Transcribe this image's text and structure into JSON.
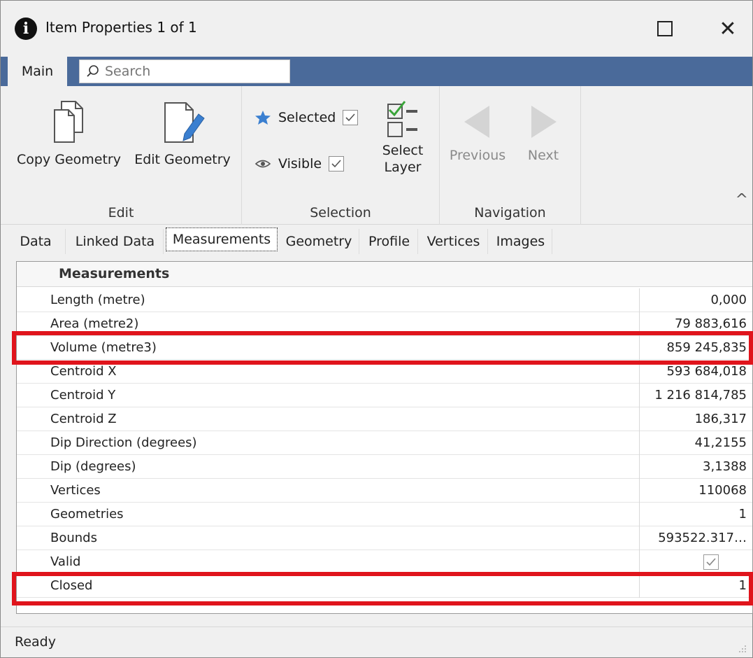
{
  "window": {
    "title": "Item Properties 1 of 1"
  },
  "ribbon": {
    "tab_main": "Main",
    "search_placeholder": "Search",
    "groups": {
      "edit": {
        "label": "Edit",
        "copy_geometry": "Copy Geometry",
        "edit_geometry": "Edit Geometry"
      },
      "selection": {
        "label": "Selection",
        "selected": "Selected",
        "selected_checked": true,
        "visible": "Visible",
        "visible_checked": true,
        "select_layer_line1": "Select",
        "select_layer_line2": "Layer"
      },
      "navigation": {
        "label": "Navigation",
        "previous": "Previous",
        "next": "Next"
      }
    }
  },
  "page_tabs": [
    "Data",
    "Linked Data",
    "Measurements",
    "Geometry",
    "Profile",
    "Vertices",
    "Images"
  ],
  "active_tab": "Measurements",
  "grid": {
    "header": "Measurements",
    "rows": [
      {
        "name": "Length (metre)",
        "value": "0,000"
      },
      {
        "name": "Area (metre2)",
        "value": "79 883,616"
      },
      {
        "name": "Volume (metre3)",
        "value": "859 245,835"
      },
      {
        "name": "Centroid X",
        "value": "593 684,018"
      },
      {
        "name": "Centroid Y",
        "value": "1 216 814,785"
      },
      {
        "name": "Centroid Z",
        "value": "186,317"
      },
      {
        "name": "Dip Direction (degrees)",
        "value": "41,2155"
      },
      {
        "name": "Dip (degrees)",
        "value": "3,1388"
      },
      {
        "name": "Vertices",
        "value": "110068"
      },
      {
        "name": "Geometries",
        "value": "1"
      },
      {
        "name": "Bounds",
        "value": "593522.317…"
      },
      {
        "name": "Valid",
        "value": ""
      },
      {
        "name": "Closed",
        "value": "1"
      }
    ],
    "valid_checked": true
  },
  "colors": {
    "tabstrip": "#4a6a9a",
    "highlight": "#e0141c",
    "accent_icon": "#3a7fd0",
    "check_green": "#3aa53a"
  },
  "status": {
    "text": "Ready"
  }
}
